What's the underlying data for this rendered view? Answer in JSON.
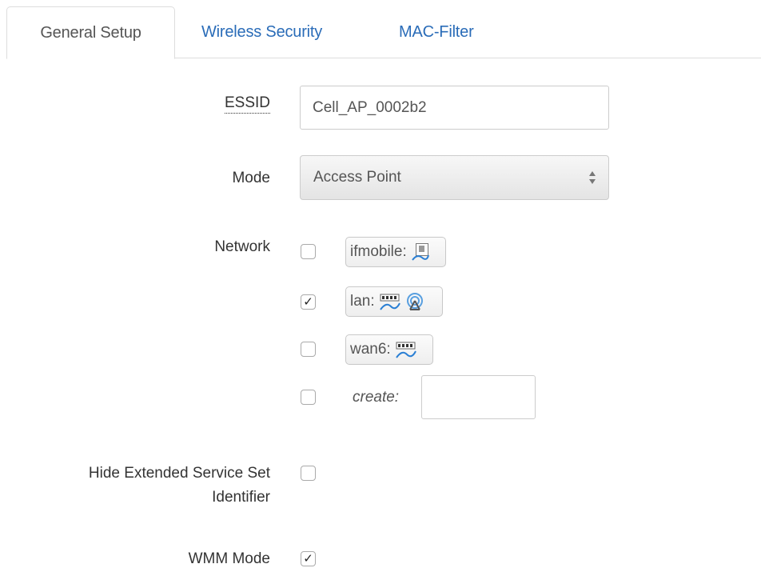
{
  "tabs": [
    {
      "label": "General Setup",
      "active": true
    },
    {
      "label": "Wireless Security",
      "active": false
    },
    {
      "label": "MAC-Filter",
      "active": false
    }
  ],
  "form": {
    "essid": {
      "label": "ESSID",
      "value": "Cell_AP_0002b2"
    },
    "mode": {
      "label": "Mode",
      "selected": "Access Point"
    },
    "network": {
      "label": "Network",
      "options": [
        {
          "name": "ifmobile:",
          "checked": false,
          "icons": [
            "mobile-interface-icon"
          ]
        },
        {
          "name": "lan:",
          "checked": true,
          "icons": [
            "ethernet-port-icon",
            "wifi-antenna-icon"
          ]
        },
        {
          "name": "wan6:",
          "checked": false,
          "icons": [
            "ethernet-port-icon"
          ]
        }
      ],
      "create": {
        "label": "create:",
        "checked": false,
        "value": ""
      }
    },
    "hide_essid": {
      "label_line1": "Hide Extended Service Set",
      "label_line2": "Identifier",
      "checked": false
    },
    "wmm": {
      "label": "WMM Mode",
      "checked": true
    }
  },
  "colors": {
    "link": "#2a6cb8",
    "border": "#dddddd",
    "text": "#333333"
  },
  "glyphs": {
    "check": "✓",
    "unchecked": ""
  }
}
